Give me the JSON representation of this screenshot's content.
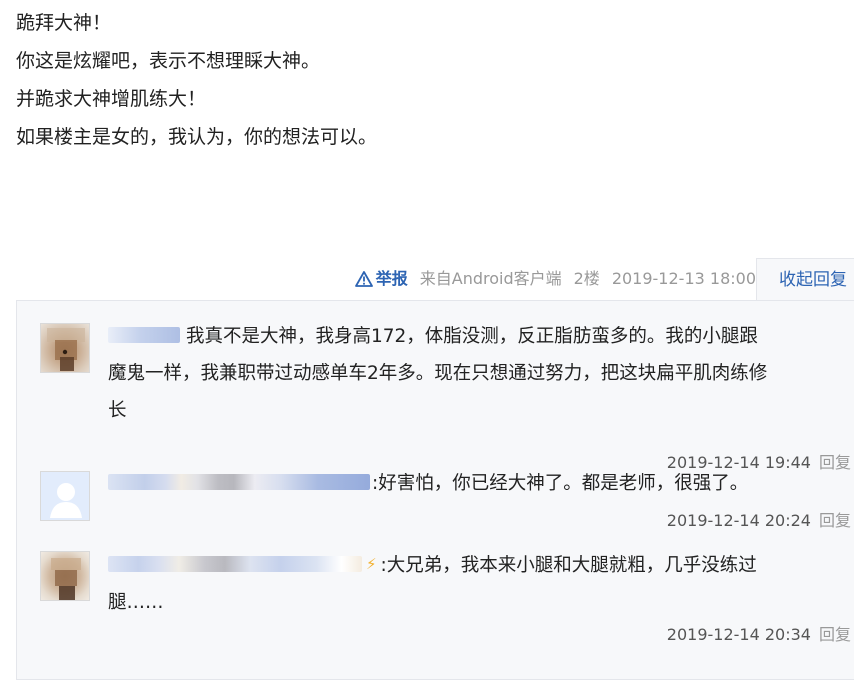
{
  "post": {
    "lines": [
      "跪拜大神！",
      "你这是炫耀吧，表示不想理睬大神。",
      "并跪求大神增肌练大！",
      "如果楼主是女的，我认为，你的想法可以。"
    ],
    "meta": {
      "report_label": "举报",
      "source": "来自Android客户端",
      "floor": "2楼",
      "time": "2019-12-13 18:00",
      "toggle_label": "收起回复"
    }
  },
  "replies": [
    {
      "avatar": "avatar-photo-blurred",
      "text_lines": [
        "我真不是大神，我身高172，体脂没测，反正脂肪蛮多的。我的小腿跟",
        "魔鬼一样，我兼职带过动感单车2年多。现在只想通过努力，把这块扁平肌肉练修",
        "长"
      ],
      "time": "2019-12-14 19:44",
      "reply_label": "回复"
    },
    {
      "avatar": "avatar-default-person",
      "text_lines": [
        ":好害怕，你已经大神了。都是老师，很强了。"
      ],
      "time": "2019-12-14 20:24",
      "reply_label": "回复"
    },
    {
      "avatar": "avatar-photo-blurred",
      "text_lines": [
        ":大兄弟，我本来小腿和大腿就粗，几乎没练过",
        "腿……"
      ],
      "time": "2019-12-14 20:34",
      "reply_label": "回复"
    }
  ],
  "colors": {
    "link": "#2d64b3",
    "meta_gray": "#999999",
    "panel_bg": "#f7f8fa"
  }
}
